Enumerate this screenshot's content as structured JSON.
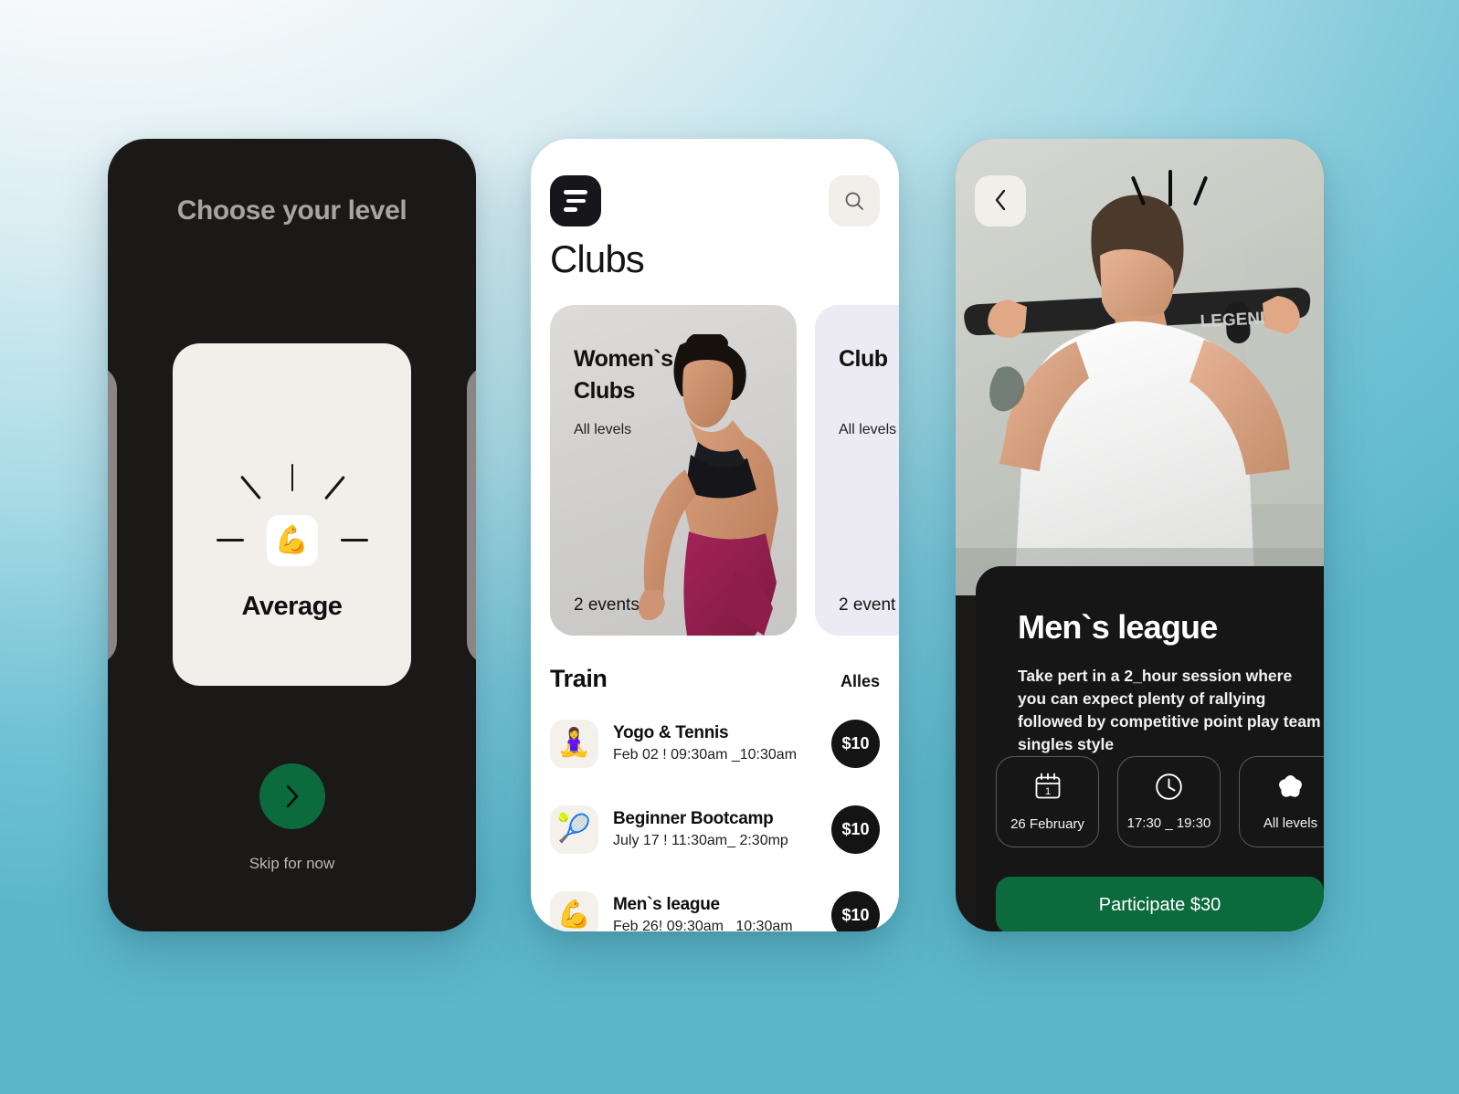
{
  "theme": {
    "dark": "#1a1918",
    "cream": "#f2efeb",
    "green": "#0c6b3d",
    "teal_bg": "#5cb7cb",
    "card_lilac": "#eceaf2"
  },
  "screen_level": {
    "title": "Choose your level",
    "card": {
      "icon": "flexed-biceps-emoji",
      "emoji": "💪",
      "level_name": "Average"
    },
    "next_button_icon": "chevron-right-icon",
    "skip_label": "Skip for now"
  },
  "screen_clubs": {
    "menu_icon": "hamburger-menu-icon",
    "search_icon": "search-icon",
    "heading": "Clubs",
    "club_cards": [
      {
        "title": "Women`s\nClubs",
        "levels": "All levels",
        "events": "2 events"
      },
      {
        "title": "Club",
        "levels": "All levels",
        "events": "2 event"
      }
    ],
    "train": {
      "title": "Train",
      "all_label": "Alles",
      "items": [
        {
          "emoji": "🧘‍♀️",
          "icon": "yoga-icon",
          "name": "Yogo & Tennis",
          "when": "Feb 02 ! 09:30am _10:30am",
          "price": "$10"
        },
        {
          "emoji": "🎾",
          "icon": "tennis-ball-icon",
          "name": "Beginner Bootcamp",
          "when": "July 17 ! 11:30am_ 2:30mp",
          "price": "$10"
        },
        {
          "emoji": "💪",
          "icon": "flexed-biceps-icon",
          "name": "Men`s league",
          "when": "Feb 26! 09:30am _10:30am",
          "price": "$10"
        }
      ]
    }
  },
  "screen_detail": {
    "back_icon": "chevron-left-icon",
    "hero_image": "man-doing-lat-pulldown-photo",
    "title": "Men`s league",
    "description": "Take pert in a 2_hour session where you can expect plenty of rallying followed by competitive point  play team singles style",
    "chips": [
      {
        "icon": "calendar-icon",
        "label": "26 February"
      },
      {
        "icon": "clock-icon",
        "label": "17:30 _ 19:30"
      },
      {
        "icon": "star-icon",
        "label": "All levels"
      }
    ],
    "cta_label": "Participate $30"
  }
}
